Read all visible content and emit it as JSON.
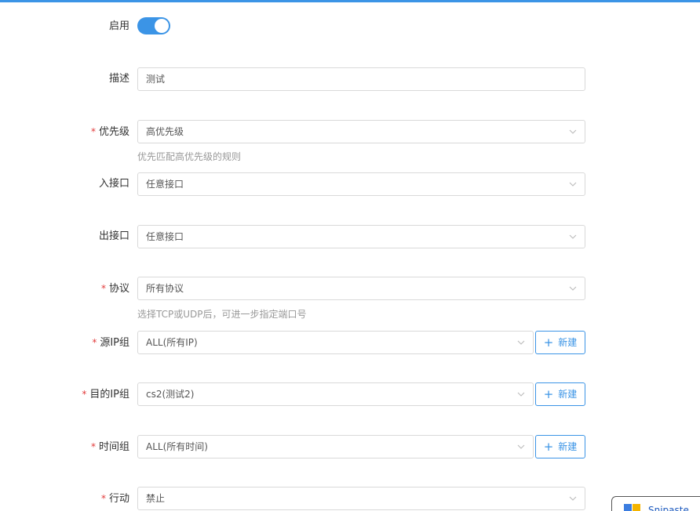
{
  "form": {
    "enable": {
      "label": "启用",
      "on": true
    },
    "description": {
      "label": "描述",
      "value": "测试"
    },
    "priority": {
      "label": "优先级",
      "required": "*",
      "value": "高优先级",
      "help": "优先匹配高优先级的规则"
    },
    "in_interface": {
      "label": "入接口",
      "value": "任意接口"
    },
    "out_interface": {
      "label": "出接口",
      "value": "任意接口"
    },
    "protocol": {
      "label": "协议",
      "required": "*",
      "value": "所有协议",
      "help": "选择TCP或UDP后，可进一步指定端口号"
    },
    "src_ip_group": {
      "label": "源IP组",
      "required": "*",
      "value": "ALL(所有IP)",
      "new_label": "新建"
    },
    "dst_ip_group": {
      "label": "目的IP组",
      "required": "*",
      "value": "cs2(测试2)",
      "new_label": "新建"
    },
    "time_group": {
      "label": "时间组",
      "required": "*",
      "value": "ALL(所有时间)",
      "new_label": "新建"
    },
    "action": {
      "label": "行动",
      "required": "*",
      "value": "禁止"
    }
  },
  "snip_tool": {
    "label": "Snipaste"
  },
  "colors": {
    "accent": "#3b94e6",
    "required": "#e23b3b",
    "border": "#d9d9d9",
    "help": "#999999"
  }
}
